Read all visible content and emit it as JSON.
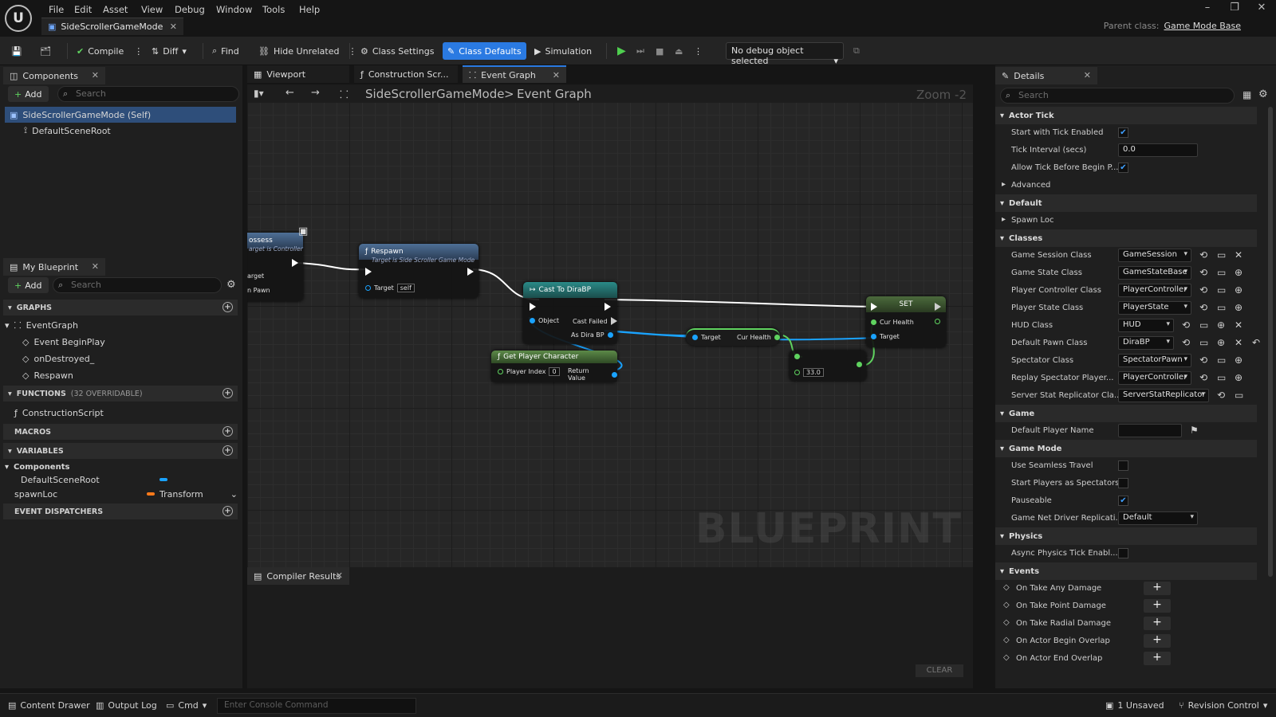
{
  "app": {
    "logo": "unreal-engine-logo",
    "menu": [
      "File",
      "Edit",
      "Asset",
      "View",
      "Debug",
      "Window",
      "Tools",
      "Help"
    ],
    "doc_tab": "SideScrollerGameMode",
    "parent_label": "Parent class:",
    "parent_value": "Game Mode Base"
  },
  "toolbar": {
    "compile": "Compile",
    "diff": "Diff",
    "find": "Find",
    "hide_unrelated": "Hide Unrelated",
    "class_settings": "Class Settings",
    "class_defaults": "Class Defaults",
    "simulation": "Simulation",
    "debug_object": "No debug object selected"
  },
  "components": {
    "tab": "Components",
    "add": "Add",
    "search_placeholder": "Search",
    "items": [
      "SideScrollerGameMode (Self)",
      "DefaultSceneRoot"
    ]
  },
  "my_blueprint": {
    "tab": "My Blueprint",
    "add": "Add",
    "search_placeholder": "Search",
    "graphs_header": "GRAPHS",
    "event_graph": "EventGraph",
    "events": [
      "Event BeginPlay",
      "onDestroyed_",
      "Respawn"
    ],
    "functions_header": "FUNCTIONS",
    "functions_count": "(32 OVERRIDABLE)",
    "function_items": [
      "ConstructionScript"
    ],
    "macros_header": "MACROS",
    "variables_header": "VARIABLES",
    "components_header": "Components",
    "variables": [
      {
        "name": "DefaultSceneRoot",
        "type": "",
        "color": "#1aa3ff"
      },
      {
        "name": "spawnLoc",
        "type": "Transform",
        "color": "#ff7a1a"
      }
    ],
    "dispatchers_header": "EVENT DISPATCHERS"
  },
  "graph_tabs": [
    "Viewport",
    "Construction Scr...",
    "Event Graph"
  ],
  "graph": {
    "breadcrumb_root": "SideScrollerGameMode",
    "breadcrumb_sep": ">",
    "breadcrumb_leaf": "Event Graph",
    "zoom": "Zoom -2",
    "watermark": "BLUEPRINT",
    "nodes": {
      "possess": {
        "title": "ossess",
        "subtitle": "arget is Controller",
        "pins": [
          "arget",
          "n Pawn"
        ]
      },
      "respawn": {
        "title": "Respawn",
        "subtitle": "Target is Side Scroller Game Mode",
        "target": "Target",
        "target_val": "self"
      },
      "cast": {
        "title": "Cast To DiraBP",
        "object": "Object",
        "cast_failed": "Cast Failed",
        "as": "As Dira BP"
      },
      "getpc": {
        "title": "Get Player Character",
        "index_label": "Player Index",
        "index_val": "0",
        "ret": "Return Value"
      },
      "curhealth": {
        "target": "Target",
        "out": "Cur Health"
      },
      "math": {
        "value": "33.0"
      },
      "set": {
        "title": "SET",
        "cur_health": "Cur Health",
        "target": "Target"
      }
    }
  },
  "compiler": {
    "tab": "Compiler Results",
    "clear": "CLEAR"
  },
  "details": {
    "tab": "Details",
    "search_placeholder": "Search",
    "actor_tick": "Actor Tick",
    "start_tick": "Start with Tick Enabled",
    "tick_interval": "Tick Interval (secs)",
    "tick_interval_val": "0.0",
    "allow_tick": "Allow Tick Before Begin P...",
    "advanced": "Advanced",
    "default": "Default",
    "spawn_loc": "Spawn Loc",
    "classes": "Classes",
    "class_rows": [
      {
        "label": "Game Session Class",
        "value": "GameSession"
      },
      {
        "label": "Game State Class",
        "value": "GameStateBase"
      },
      {
        "label": "Player Controller Class",
        "value": "PlayerController"
      },
      {
        "label": "Player State Class",
        "value": "PlayerState"
      },
      {
        "label": "HUD Class",
        "value": "HUD"
      },
      {
        "label": "Default Pawn Class",
        "value": "DiraBP"
      },
      {
        "label": "Spectator Class",
        "value": "SpectatorPawn"
      },
      {
        "label": "Replay Spectator Player...",
        "value": "PlayerController"
      },
      {
        "label": "Server Stat Replicator Cla...",
        "value": "ServerStatReplicator"
      }
    ],
    "game": "Game",
    "default_player_name": "Default Player Name",
    "game_mode": "Game Mode",
    "seamless": "Use Seamless Travel",
    "spectators": "Start Players as Spectators",
    "pauseable": "Pauseable",
    "net_driver": "Game Net Driver Replicati...",
    "net_driver_val": "Default",
    "physics": "Physics",
    "async_tick": "Async Physics Tick Enabl...",
    "events": "Events",
    "event_rows": [
      "On Take Any Damage",
      "On Take Point Damage",
      "On Take Radial Damage",
      "On Actor Begin Overlap",
      "On Actor End Overlap"
    ]
  },
  "status": {
    "content_drawer": "Content Drawer",
    "output_log": "Output Log",
    "cmd": "Cmd",
    "console_placeholder": "Enter Console Command",
    "unsaved": "1 Unsaved",
    "revision": "Revision Control"
  }
}
